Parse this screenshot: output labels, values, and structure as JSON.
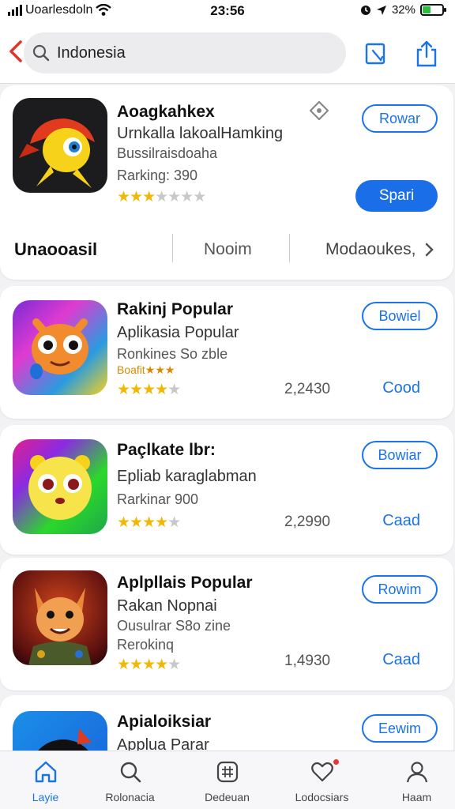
{
  "status_bar": {
    "carrier": "Uoarlesdoln",
    "time": "23:56",
    "battery": "32%"
  },
  "header": {
    "search_value": "Indonesia"
  },
  "featured": {
    "title": "Aoagkahkex",
    "subtitle": "Urnkalla lakoalHamking",
    "line2": "Bussilraisdoaha",
    "ranking": "Rarking: 390",
    "rating": 3,
    "button_outline": "Rowar",
    "button_fill": "Spari",
    "segments": [
      "Unaooasil",
      "Nooim",
      "Modaoukes,"
    ]
  },
  "apps": [
    {
      "title": "Rakinj Popular",
      "subtitle": "Aplikasia Popular",
      "line1": "Ronkines So zble",
      "line2": "Boafit★★★",
      "rating": 4,
      "count": "2,2430",
      "button": "Bowiel",
      "link": "Cood"
    },
    {
      "title": "Paçlkate lbr:",
      "subtitle": "Epliab karaglabman",
      "line1": "Rarkinar 900",
      "line2": "",
      "rating": 4,
      "count": "2,2990",
      "button": "Bowiar",
      "link": "Caad"
    },
    {
      "title": "Aplpllais Popular",
      "subtitle": "Rakan Nopnai",
      "line1": "Ousulrar S8o zine",
      "line2": "Rerokinq",
      "rating": 4,
      "count": "1,4930",
      "button": "Rowim",
      "link": "Caad"
    },
    {
      "title": "Apialoiksiar",
      "subtitle": "Applua Parar",
      "line1": "",
      "line2": "",
      "rating": 0,
      "count": "",
      "button": "Eewim",
      "link": ""
    }
  ],
  "tabs": [
    {
      "label": "Layie",
      "icon": "home-icon"
    },
    {
      "label": "Rolonacia",
      "icon": "search-icon"
    },
    {
      "label": "Dedeuan",
      "icon": "grid-icon"
    },
    {
      "label": "Lodocsiars",
      "icon": "heart-icon"
    },
    {
      "label": "Haam",
      "icon": "profile-icon"
    }
  ],
  "colors": {
    "accent": "#1a73e8",
    "star": "#f2b705",
    "battery": "#2bbd3f"
  }
}
